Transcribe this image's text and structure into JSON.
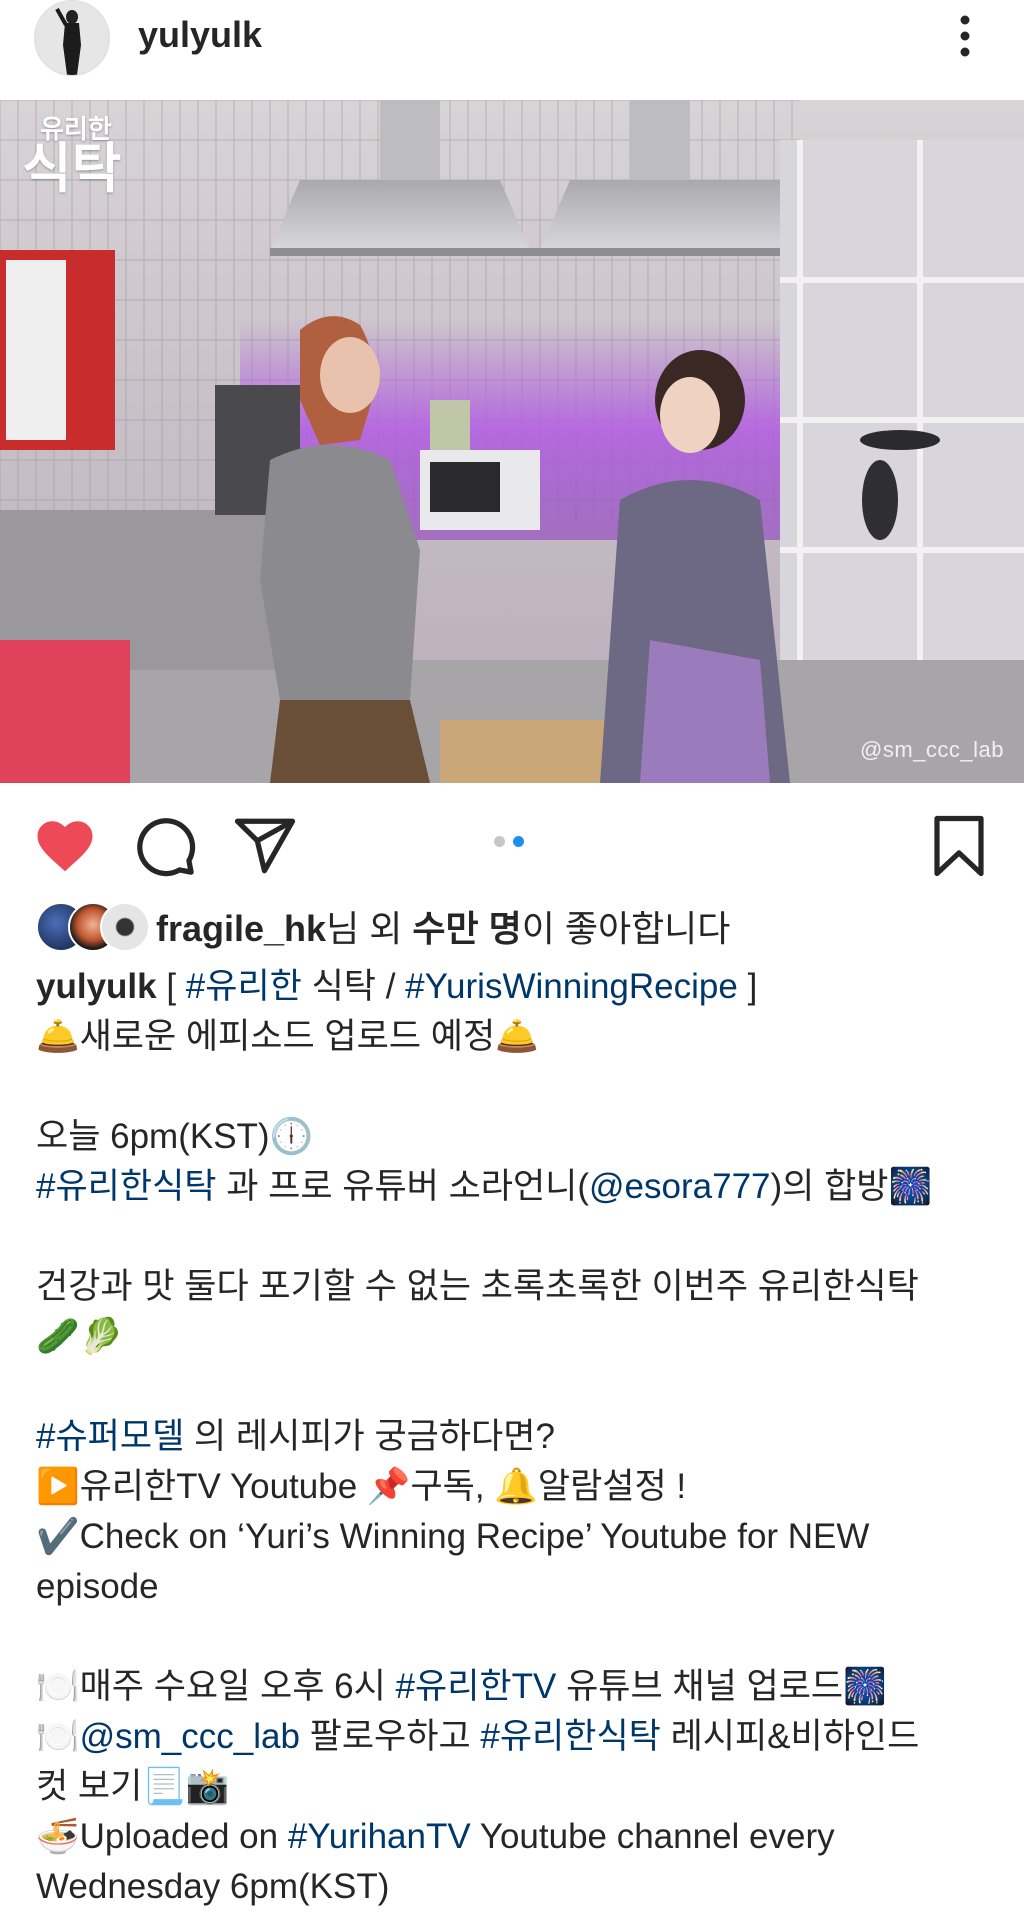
{
  "header": {
    "username": "yulyulk",
    "more_icon": "more-vertical-icon"
  },
  "photo": {
    "logo_small": "유리한",
    "logo_big": "식탁",
    "watermark": "@sm_ccc_lab"
  },
  "actions": {
    "like_icon": "heart-filled-icon",
    "comment_icon": "comment-icon",
    "share_icon": "send-icon",
    "save_icon": "bookmark-icon",
    "carousel": {
      "count": 2,
      "active_index": 1
    },
    "colors": {
      "liked": "#ed4956",
      "dot_active": "#1f8ef1",
      "dot_inactive": "#c7c7c7",
      "link": "#00376b"
    }
  },
  "likes": {
    "user": "fragile_hk",
    "mid": "님 외 ",
    "count": "수만 명",
    "suffix": "이 좋아합니다"
  },
  "caption": {
    "l1_user": "yulyulk",
    "l1_a": " [ ",
    "l1_tag1": "#유리한",
    "l1_b": " 식탁 / ",
    "l1_tag2": "#YurisWinningRecipe",
    "l1_c": " ]",
    "l2": "🛎️새로운 에피소드 업로드 예정🛎️",
    "l3": "오늘 6pm(KST)🕕",
    "l4_tag": "#유리한식탁",
    "l4_a": " 과 프로 유튜버 소라언니(",
    "l4_mention": "@esora777",
    "l4_b": ")의 합방🎆",
    "l5": "건강과 맛 둘다 포기할 수 없는 초록초록한 이번주 유리한식탁",
    "l6": "🥒🥬",
    "l7_tag": "#슈퍼모델",
    "l7_a": " 의 레시피가 궁금하다면?",
    "l8": "▶️유리한TV Youtube 📌구독, 🔔알람설정 !",
    "l9": "✔️Check on ‘Yuri’s Winning Recipe’ Youtube for NEW",
    "l10": "episode",
    "l11_a": "🍽️매주 수요일 오후 6시 ",
    "l11_tag": "#유리한TV",
    "l11_b": " 유튜브 채널 업로드🎆",
    "l12_a": "🍽️",
    "l12_mention": "@sm_ccc_lab",
    "l12_b": " 팔로우하고 ",
    "l12_tag": "#유리한식탁",
    "l12_c": " 레시피&비하인드",
    "l13": "컷 보기📃📸",
    "l14_a": "🍜Uploaded on ",
    "l14_tag": "#YurihanTV",
    "l14_b": " Youtube channel every",
    "l15": "Wednesday 6pm(KST)"
  }
}
